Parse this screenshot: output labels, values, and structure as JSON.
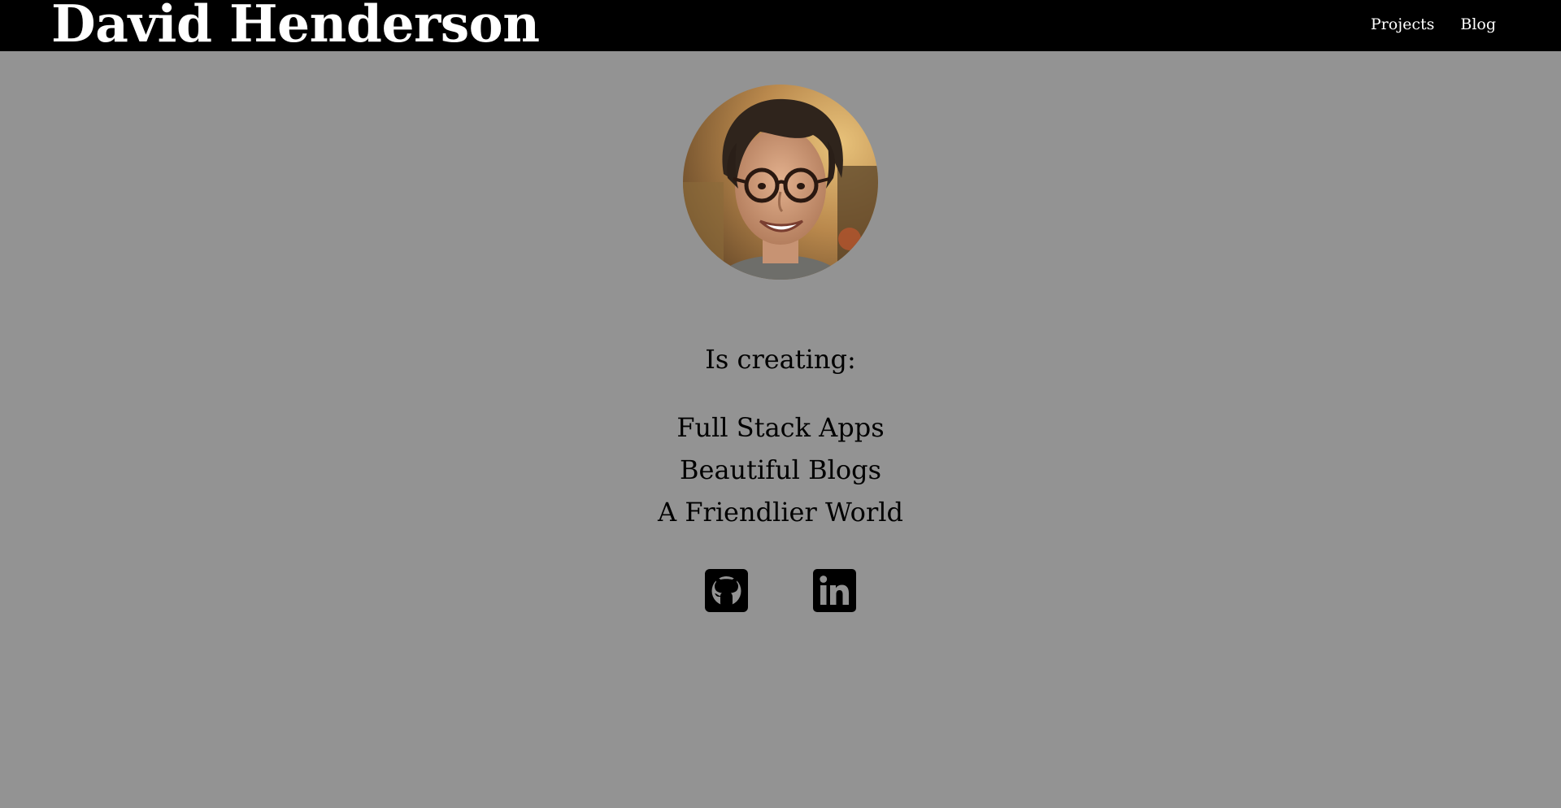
{
  "header": {
    "title": "David Henderson",
    "nav": [
      {
        "label": "Projects"
      },
      {
        "label": "Blog"
      }
    ],
    "background_color": "#000000",
    "text_color": "#ffffff"
  },
  "page": {
    "background_color": "#939393"
  },
  "profile": {
    "avatar_icon": "profile-photo"
  },
  "main": {
    "subtitle": "Is creating:",
    "items": [
      "Full Stack Apps",
      "Beautiful Blogs",
      "A Friendlier World"
    ]
  },
  "social": {
    "links": [
      {
        "icon": "github-icon"
      },
      {
        "icon": "linkedin-icon"
      }
    ]
  }
}
